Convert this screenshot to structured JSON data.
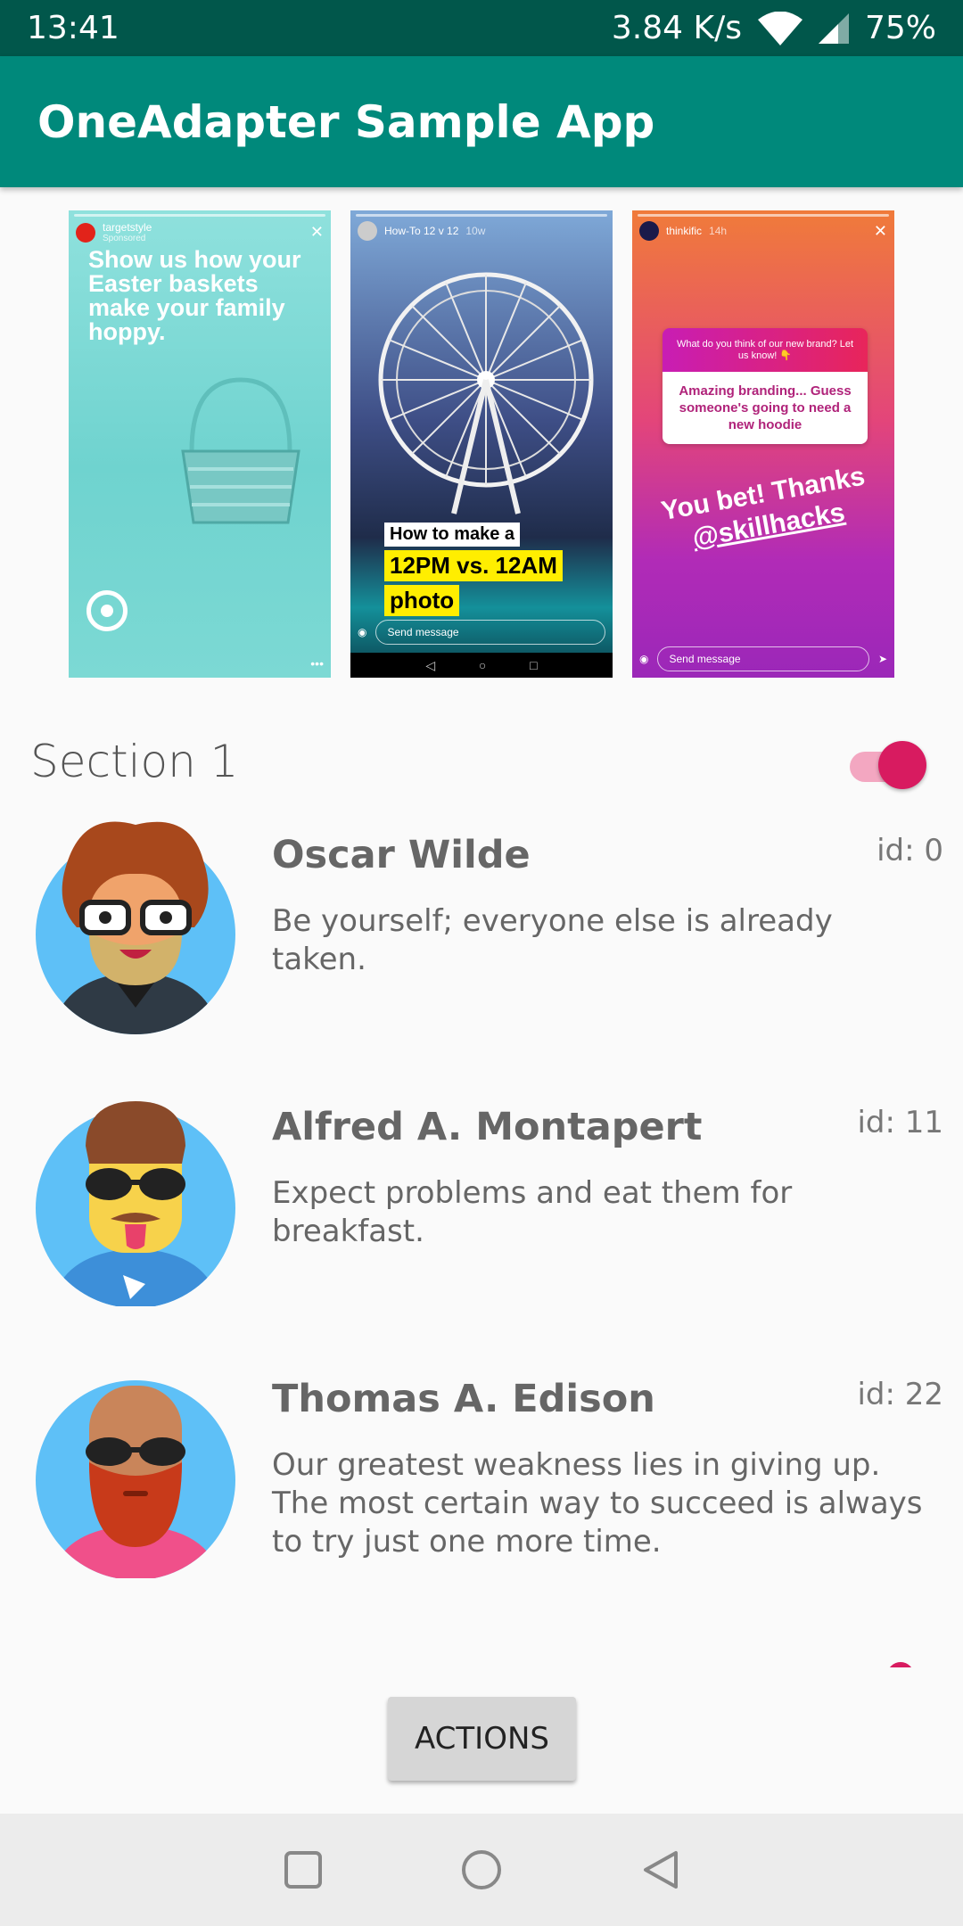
{
  "status_bar": {
    "time": "13:41",
    "network_speed": "3.84 K/s",
    "battery": "75%",
    "wifi_icon": "wifi-icon",
    "signal_icon": "signal-icon"
  },
  "app_bar": {
    "title": "OneAdapter Sample App"
  },
  "stories": [
    {
      "account": "targetstyle",
      "subtitle": "Sponsored",
      "text": "Show us how your Easter baskets make your family hoppy."
    },
    {
      "account": "How-To 12 v 12",
      "age": "10w",
      "caption_line1": "How to make a",
      "caption_line2": "12PM vs. 12AM",
      "caption_line3": "photo",
      "send_message": "Send message"
    },
    {
      "account": "thinkific",
      "age": "14h",
      "poll_question": "What do you think of our new brand? Let us know! 👇",
      "poll_answer": "Amazing branding... Guess someone's going to need a new hoodie",
      "big_text_line1": "You bet! Thanks",
      "big_text_line2": "@skillhacks",
      "send_message": "Send message"
    }
  ],
  "section": {
    "title": "Section 1",
    "toggle_on": true
  },
  "messages": [
    {
      "name": "Oscar Wilde",
      "id": "id: 0",
      "body": "Be yourself; everyone else is already taken."
    },
    {
      "name": "Alfred A. Montapert",
      "id": "id: 11",
      "body": "Expect problems and eat them for breakfast."
    },
    {
      "name": "Thomas A. Edison",
      "id": "id: 22",
      "body": "Our greatest weakness lies in giving up. The most certain way to succeed is always to try just one more time."
    }
  ],
  "actions_button": {
    "label": "ACTIONS"
  },
  "colors": {
    "status_bar": "#01574b",
    "app_bar": "#00897b",
    "accent": "#d81b60",
    "avatar_bg": "#5ec0f7"
  },
  "nav_bar": {
    "recents_icon": "square-icon",
    "home_icon": "circle-icon",
    "back_icon": "triangle-back-icon"
  }
}
